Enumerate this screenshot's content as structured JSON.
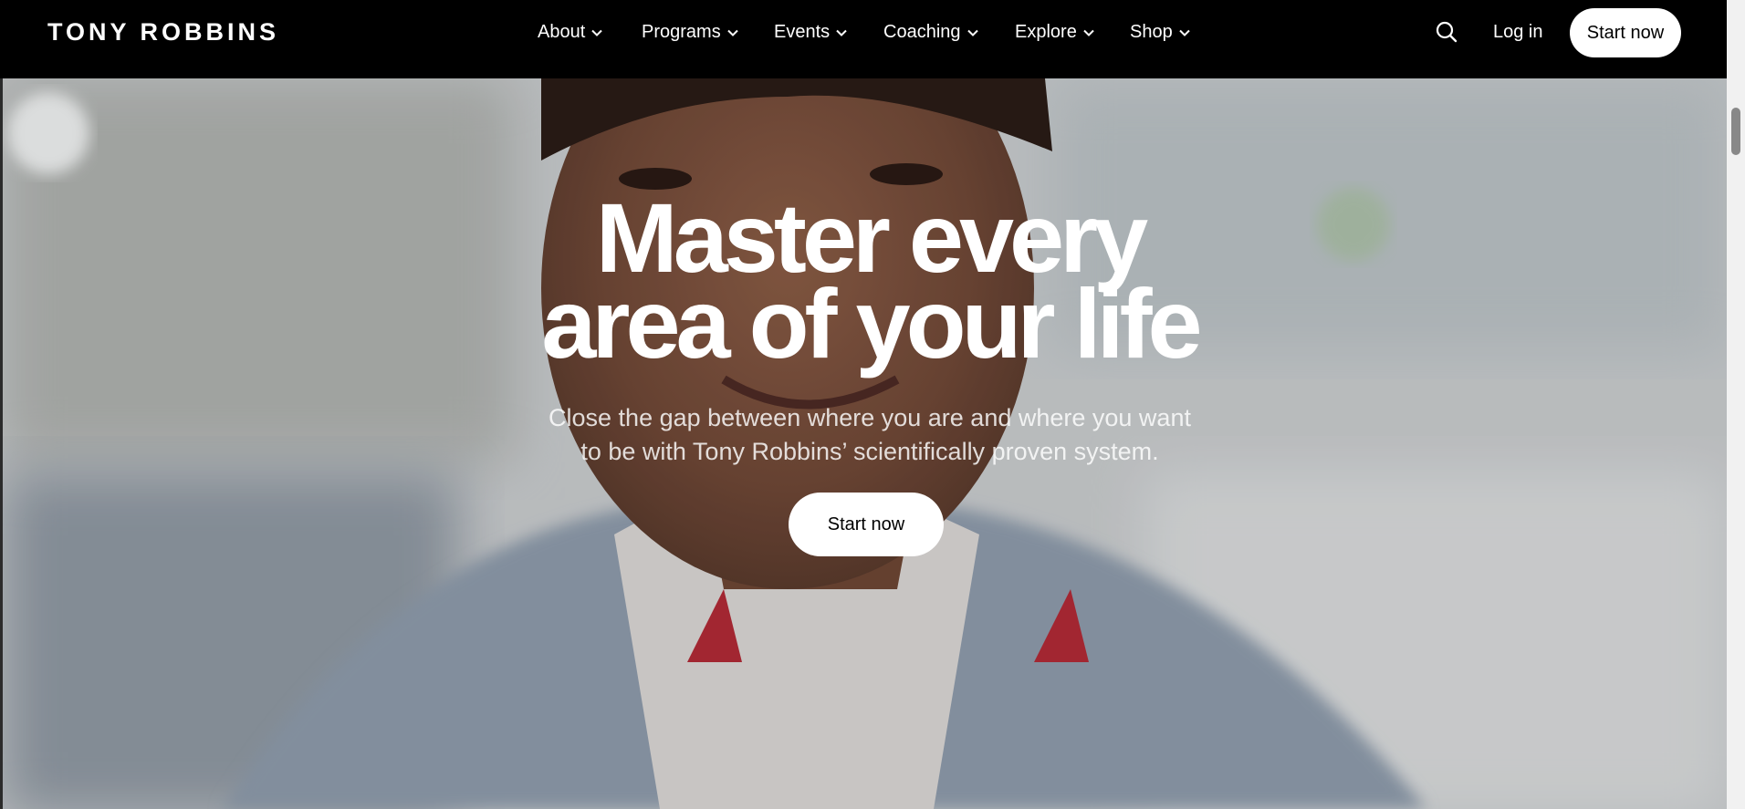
{
  "header": {
    "logo": "TONY ROBBINS",
    "nav": [
      {
        "label": "About",
        "icon": "chevron-down-icon"
      },
      {
        "label": "Programs",
        "icon": "chevron-down-icon"
      },
      {
        "label": "Events",
        "icon": "chevron-down-icon"
      },
      {
        "label": "Coaching",
        "icon": "chevron-down-icon"
      },
      {
        "label": "Explore",
        "icon": "chevron-down-icon"
      },
      {
        "label": "Shop",
        "icon": "chevron-down-icon"
      }
    ],
    "search_icon": "search-icon",
    "login_label": "Log in",
    "cta_label": "Start now"
  },
  "hero": {
    "headline_line1": "Master every",
    "headline_line2": "area of your life",
    "subtitle_line1": "Close the gap between where you are and where you want",
    "subtitle_line2": "to be with Tony Robbins’ scientifically proven system.",
    "cta_label": "Start now"
  },
  "colors": {
    "nav_background": "#000000",
    "button_background": "#ffffff",
    "text_light": "#ffffff"
  }
}
